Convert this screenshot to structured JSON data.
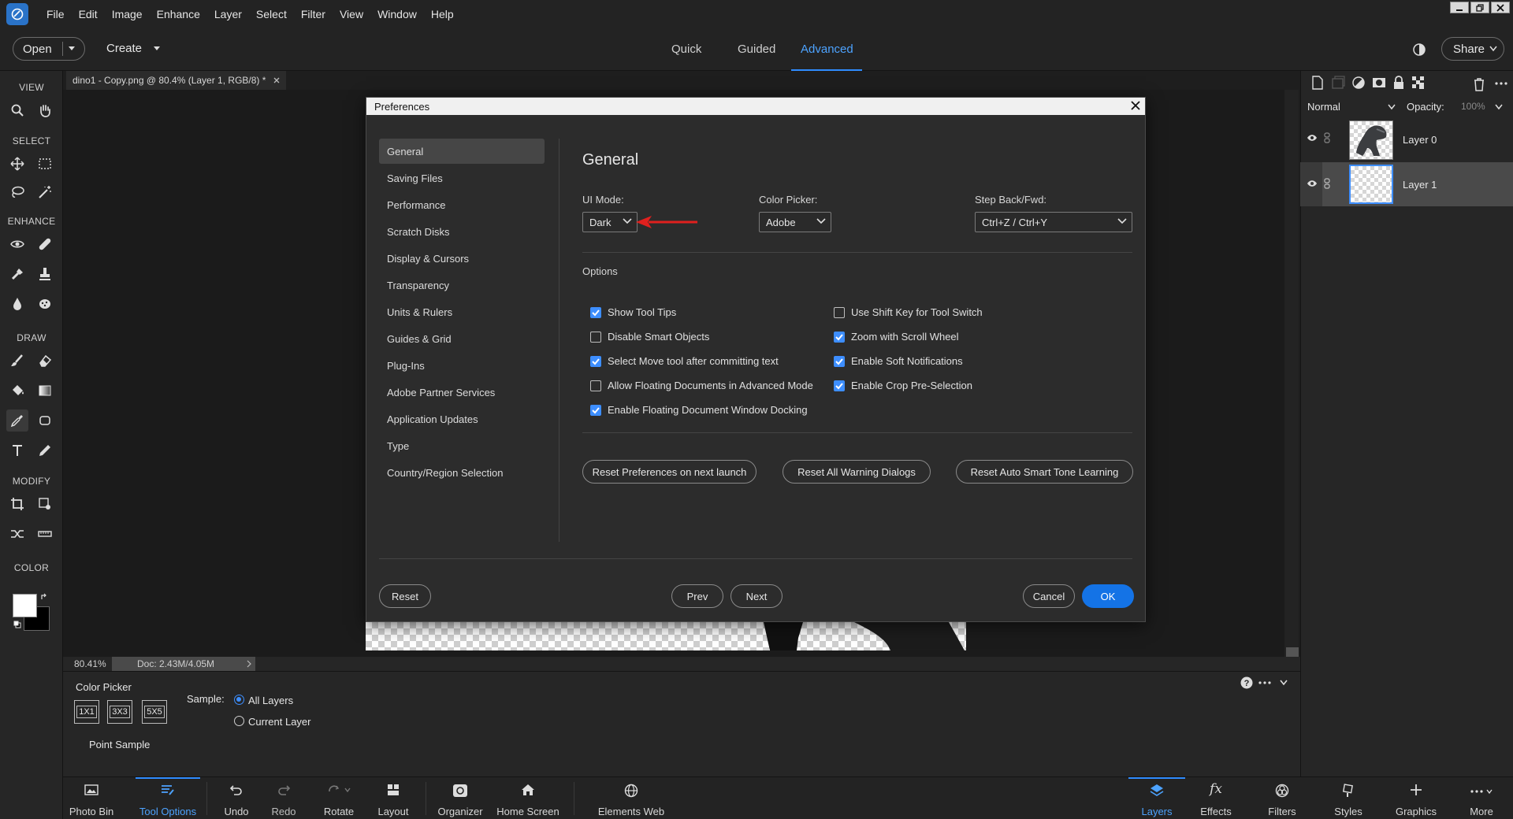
{
  "menubar": {
    "items": [
      "File",
      "Edit",
      "Image",
      "Enhance",
      "Layer",
      "Select",
      "Filter",
      "View",
      "Window",
      "Help"
    ]
  },
  "topbar": {
    "open_label": "Open",
    "create_label": "Create",
    "modes": [
      "Quick",
      "Guided",
      "Advanced"
    ],
    "active_mode": "Advanced",
    "share_label": "Share"
  },
  "toolbar": {
    "sections": [
      "VIEW",
      "SELECT",
      "ENHANCE",
      "DRAW",
      "MODIFY",
      "COLOR"
    ]
  },
  "document": {
    "tab_title": "dino1 - Copy.png @ 80.4% (Layer 1, RGB/8) *",
    "zoom": "80.41%",
    "doc_size": "Doc: 2.43M/4.05M"
  },
  "tool_options": {
    "title": "Color Picker",
    "sizes": [
      "1X1",
      "3X3",
      "5X5"
    ],
    "size_label": "Point Sample",
    "sample_label": "Sample:",
    "sample_options": [
      "All Layers",
      "Current Layer"
    ],
    "sample_selected": "All Layers"
  },
  "taskbar": {
    "left": [
      "Photo Bin",
      "Tool Options",
      "Undo",
      "Redo",
      "Rotate",
      "Layout",
      "Organizer",
      "Home Screen",
      "Elements Web"
    ],
    "right": [
      "Layers",
      "Effects",
      "Filters",
      "Styles",
      "Graphics",
      "More"
    ],
    "active_left": "Tool Options",
    "active_right": "Layers"
  },
  "layers_panel": {
    "blend_mode": "Normal",
    "opacity_label": "Opacity:",
    "opacity_value": "100%",
    "layers": [
      "Layer 0",
      "Layer 1"
    ],
    "selected_layer": "Layer 1"
  },
  "dialog": {
    "title": "Preferences",
    "nav": [
      "General",
      "Saving Files",
      "Performance",
      "Scratch Disks",
      "Display & Cursors",
      "Transparency",
      "Units & Rulers",
      "Guides & Grid",
      "Plug-Ins",
      "Adobe Partner Services",
      "Application Updates",
      "Type",
      "Country/Region Selection"
    ],
    "selected_nav": "General",
    "heading": "General",
    "ui_mode_label": "UI Mode:",
    "ui_mode_value": "Dark",
    "color_picker_label": "Color Picker:",
    "color_picker_value": "Adobe",
    "step_label": "Step Back/Fwd:",
    "step_value": "Ctrl+Z / Ctrl+Y",
    "options_label": "Options",
    "options_left": [
      {
        "label": "Show Tool Tips",
        "checked": true
      },
      {
        "label": "Disable Smart Objects",
        "checked": false
      },
      {
        "label": "Select Move tool after committing text",
        "checked": true
      },
      {
        "label": "Allow Floating Documents in Advanced Mode",
        "checked": false
      },
      {
        "label": "Enable Floating Document Window Docking",
        "checked": true
      }
    ],
    "options_right": [
      {
        "label": "Use Shift Key for Tool Switch",
        "checked": false
      },
      {
        "label": "Zoom with Scroll Wheel",
        "checked": true
      },
      {
        "label": "Enable Soft Notifications",
        "checked": true
      },
      {
        "label": "Enable Crop Pre-Selection",
        "checked": true
      }
    ],
    "reset_prefs_label": "Reset Preferences on next launch",
    "reset_warnings_label": "Reset All Warning Dialogs",
    "reset_tone_label": "Reset Auto Smart Tone Learning",
    "reset_label": "Reset",
    "prev_label": "Prev",
    "next_label": "Next",
    "cancel_label": "Cancel",
    "ok_label": "OK"
  },
  "colors": {
    "accent": "#1473e6",
    "annotation_arrow": "#e0201e"
  }
}
